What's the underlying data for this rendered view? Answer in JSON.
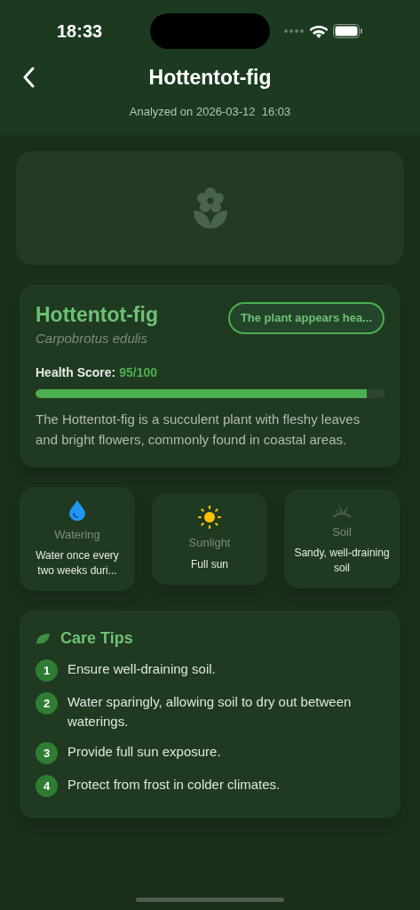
{
  "status_bar": {
    "time": "18:33"
  },
  "header": {
    "title": "Hottentot-fig",
    "subtitle": "Analyzed on 2026-03-12  16:03"
  },
  "plant": {
    "name": "Hottentot-fig",
    "scientific_name": "Carpobrotus edulis",
    "badge": "The plant appears hea...",
    "health_label": "Health Score:",
    "health_value": "95/100",
    "level": 0.95,
    "description": "The Hottentot-fig is a succulent plant with fleshy leaves and bright flowers, commonly found in coastal areas."
  },
  "info_cards": [
    {
      "kind": "watering",
      "title": "Watering",
      "value": "Water once every two weeks duri..."
    },
    {
      "kind": "sunlight",
      "title": "Sunlight",
      "value": "Full sun"
    },
    {
      "kind": "soil",
      "title": "Soil",
      "value": "Sandy, well-draining soil"
    }
  ],
  "care_tips": {
    "title": "Care Tips",
    "items": [
      {
        "number": "1",
        "text": "Ensure well-draining soil."
      },
      {
        "number": "2",
        "text": "Water sparingly, allowing soil to dry out between waterings."
      },
      {
        "number": "3",
        "text": "Provide full sun exposure."
      },
      {
        "number": "4",
        "text": "Protect from frost in colder climates."
      }
    ]
  }
}
